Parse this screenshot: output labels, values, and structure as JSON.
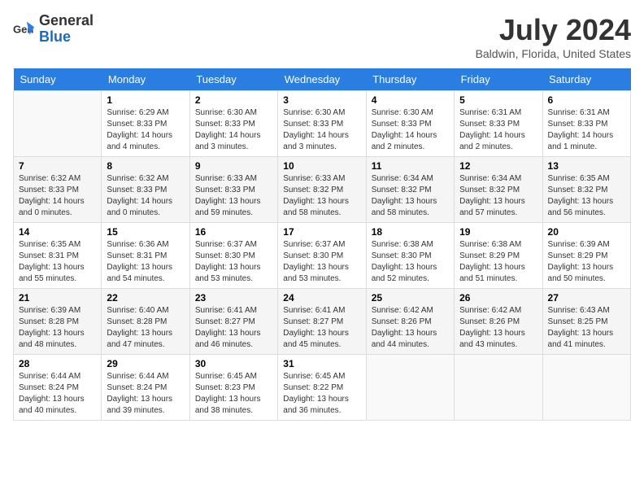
{
  "header": {
    "logo_general": "General",
    "logo_blue": "Blue",
    "month_year": "July 2024",
    "location": "Baldwin, Florida, United States"
  },
  "columns": [
    "Sunday",
    "Monday",
    "Tuesday",
    "Wednesday",
    "Thursday",
    "Friday",
    "Saturday"
  ],
  "weeks": [
    [
      {
        "day": "",
        "info": ""
      },
      {
        "day": "1",
        "info": "Sunrise: 6:29 AM\nSunset: 8:33 PM\nDaylight: 14 hours\nand 4 minutes."
      },
      {
        "day": "2",
        "info": "Sunrise: 6:30 AM\nSunset: 8:33 PM\nDaylight: 14 hours\nand 3 minutes."
      },
      {
        "day": "3",
        "info": "Sunrise: 6:30 AM\nSunset: 8:33 PM\nDaylight: 14 hours\nand 3 minutes."
      },
      {
        "day": "4",
        "info": "Sunrise: 6:30 AM\nSunset: 8:33 PM\nDaylight: 14 hours\nand 2 minutes."
      },
      {
        "day": "5",
        "info": "Sunrise: 6:31 AM\nSunset: 8:33 PM\nDaylight: 14 hours\nand 2 minutes."
      },
      {
        "day": "6",
        "info": "Sunrise: 6:31 AM\nSunset: 8:33 PM\nDaylight: 14 hours\nand 1 minute."
      }
    ],
    [
      {
        "day": "7",
        "info": "Sunrise: 6:32 AM\nSunset: 8:33 PM\nDaylight: 14 hours\nand 0 minutes."
      },
      {
        "day": "8",
        "info": "Sunrise: 6:32 AM\nSunset: 8:33 PM\nDaylight: 14 hours\nand 0 minutes."
      },
      {
        "day": "9",
        "info": "Sunrise: 6:33 AM\nSunset: 8:33 PM\nDaylight: 13 hours\nand 59 minutes."
      },
      {
        "day": "10",
        "info": "Sunrise: 6:33 AM\nSunset: 8:32 PM\nDaylight: 13 hours\nand 58 minutes."
      },
      {
        "day": "11",
        "info": "Sunrise: 6:34 AM\nSunset: 8:32 PM\nDaylight: 13 hours\nand 58 minutes."
      },
      {
        "day": "12",
        "info": "Sunrise: 6:34 AM\nSunset: 8:32 PM\nDaylight: 13 hours\nand 57 minutes."
      },
      {
        "day": "13",
        "info": "Sunrise: 6:35 AM\nSunset: 8:32 PM\nDaylight: 13 hours\nand 56 minutes."
      }
    ],
    [
      {
        "day": "14",
        "info": "Sunrise: 6:35 AM\nSunset: 8:31 PM\nDaylight: 13 hours\nand 55 minutes."
      },
      {
        "day": "15",
        "info": "Sunrise: 6:36 AM\nSunset: 8:31 PM\nDaylight: 13 hours\nand 54 minutes."
      },
      {
        "day": "16",
        "info": "Sunrise: 6:37 AM\nSunset: 8:30 PM\nDaylight: 13 hours\nand 53 minutes."
      },
      {
        "day": "17",
        "info": "Sunrise: 6:37 AM\nSunset: 8:30 PM\nDaylight: 13 hours\nand 53 minutes."
      },
      {
        "day": "18",
        "info": "Sunrise: 6:38 AM\nSunset: 8:30 PM\nDaylight: 13 hours\nand 52 minutes."
      },
      {
        "day": "19",
        "info": "Sunrise: 6:38 AM\nSunset: 8:29 PM\nDaylight: 13 hours\nand 51 minutes."
      },
      {
        "day": "20",
        "info": "Sunrise: 6:39 AM\nSunset: 8:29 PM\nDaylight: 13 hours\nand 50 minutes."
      }
    ],
    [
      {
        "day": "21",
        "info": "Sunrise: 6:39 AM\nSunset: 8:28 PM\nDaylight: 13 hours\nand 48 minutes."
      },
      {
        "day": "22",
        "info": "Sunrise: 6:40 AM\nSunset: 8:28 PM\nDaylight: 13 hours\nand 47 minutes."
      },
      {
        "day": "23",
        "info": "Sunrise: 6:41 AM\nSunset: 8:27 PM\nDaylight: 13 hours\nand 46 minutes."
      },
      {
        "day": "24",
        "info": "Sunrise: 6:41 AM\nSunset: 8:27 PM\nDaylight: 13 hours\nand 45 minutes."
      },
      {
        "day": "25",
        "info": "Sunrise: 6:42 AM\nSunset: 8:26 PM\nDaylight: 13 hours\nand 44 minutes."
      },
      {
        "day": "26",
        "info": "Sunrise: 6:42 AM\nSunset: 8:26 PM\nDaylight: 13 hours\nand 43 minutes."
      },
      {
        "day": "27",
        "info": "Sunrise: 6:43 AM\nSunset: 8:25 PM\nDaylight: 13 hours\nand 41 minutes."
      }
    ],
    [
      {
        "day": "28",
        "info": "Sunrise: 6:44 AM\nSunset: 8:24 PM\nDaylight: 13 hours\nand 40 minutes."
      },
      {
        "day": "29",
        "info": "Sunrise: 6:44 AM\nSunset: 8:24 PM\nDaylight: 13 hours\nand 39 minutes."
      },
      {
        "day": "30",
        "info": "Sunrise: 6:45 AM\nSunset: 8:23 PM\nDaylight: 13 hours\nand 38 minutes."
      },
      {
        "day": "31",
        "info": "Sunrise: 6:45 AM\nSunset: 8:22 PM\nDaylight: 13 hours\nand 36 minutes."
      },
      {
        "day": "",
        "info": ""
      },
      {
        "day": "",
        "info": ""
      },
      {
        "day": "",
        "info": ""
      }
    ]
  ]
}
